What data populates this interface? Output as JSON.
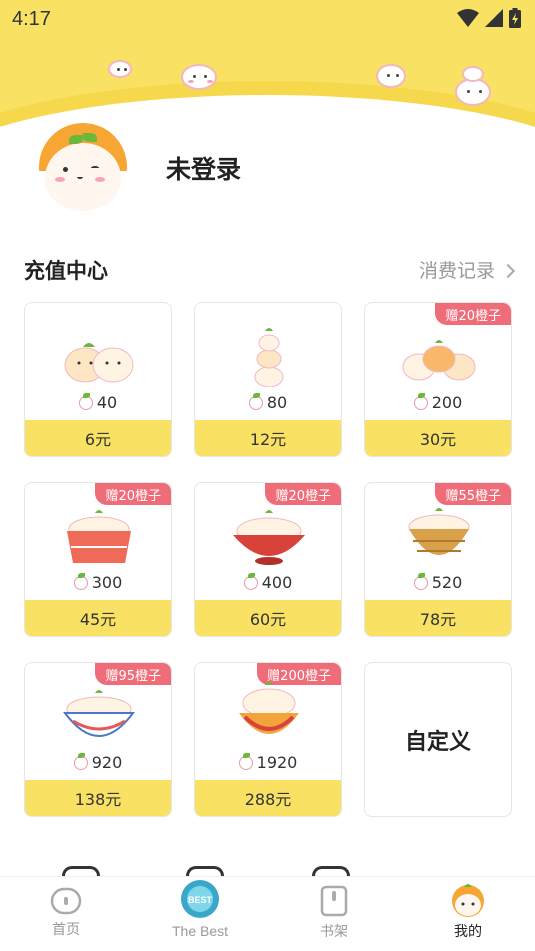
{
  "status_bar": {
    "time": "4:17"
  },
  "profile": {
    "username": "未登录"
  },
  "recharge": {
    "title": "充值中心",
    "history_link": "消费记录",
    "cards": [
      {
        "amount": "40",
        "price": "6元",
        "badge": ""
      },
      {
        "amount": "80",
        "price": "12元",
        "badge": ""
      },
      {
        "amount": "200",
        "price": "30元",
        "badge": "赠20橙子"
      },
      {
        "amount": "300",
        "price": "45元",
        "badge": "赠20橙子"
      },
      {
        "amount": "400",
        "price": "60元",
        "badge": "赠20橙子"
      },
      {
        "amount": "520",
        "price": "78元",
        "badge": "赠55橙子"
      },
      {
        "amount": "920",
        "price": "138元",
        "badge": "赠95橙子"
      },
      {
        "amount": "1920",
        "price": "288元",
        "badge": "赠200橙子"
      }
    ],
    "custom_label": "自定义"
  },
  "nav": {
    "items": [
      {
        "label": "首页",
        "icon": "home-icon"
      },
      {
        "label": "The Best",
        "icon": "the-best-icon"
      },
      {
        "label": "书架",
        "icon": "bookshelf-icon"
      },
      {
        "label": "我的",
        "icon": "profile-icon"
      }
    ],
    "active": "我的"
  },
  "colors": {
    "accent_yellow": "#f8e163",
    "badge_red": "#ee6d79",
    "text_dark": "#222222",
    "text_muted": "#999999"
  }
}
